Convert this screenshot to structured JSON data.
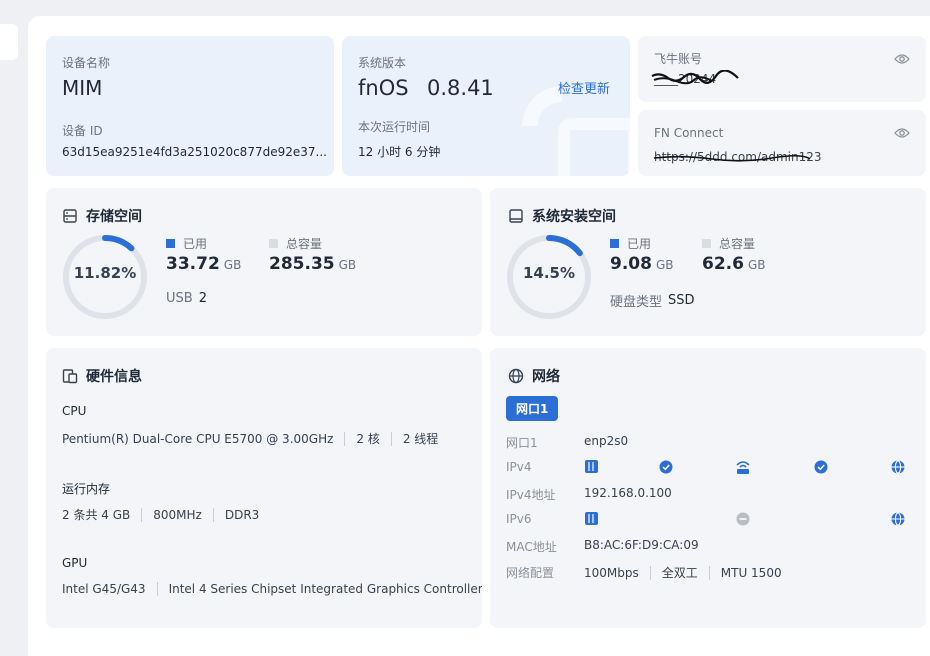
{
  "device": {
    "name_label": "设备名称",
    "name": "MIM",
    "id_label": "设备 ID",
    "id": "63d15ea9251e4fd3a251020c877de92e37..."
  },
  "system": {
    "version_label": "系统版本",
    "os_name": "fnOS",
    "version": "0.8.41",
    "check_update": "检查更新",
    "uptime_label": "本次运行时间",
    "uptime": "12 小时 6 分钟"
  },
  "account": {
    "label": "飞牛账号",
    "value": "____20244"
  },
  "fn_connect": {
    "label": "FN Connect",
    "value": "https://5ddd.com/admin123"
  },
  "storage": {
    "title": "存储空间",
    "percent": "11.82%",
    "percent_value": 11.82,
    "used_label": "已用",
    "used_value": "33.72",
    "used_unit": "GB",
    "total_label": "总容量",
    "total_value": "285.35",
    "total_unit": "GB",
    "usb_label": "USB",
    "usb_value": "2"
  },
  "sys_storage": {
    "title": "系统安装空间",
    "percent": "14.5%",
    "percent_value": 14.5,
    "used_label": "已用",
    "used_value": "9.08",
    "used_unit": "GB",
    "total_label": "总容量",
    "total_value": "62.6",
    "total_unit": "GB",
    "disk_type_label": "硬盘类型",
    "disk_type": "SSD"
  },
  "hardware": {
    "title": "硬件信息",
    "cpu_label": "CPU",
    "cpu_model": "Pentium(R) Dual-Core CPU E5700 @ 3.00GHz",
    "cpu_cores": "2 核",
    "cpu_threads": "2 线程",
    "mem_label": "运行内存",
    "mem_sticks": "2 条共 4 GB",
    "mem_freq": "800MHz",
    "mem_type": "DDR3",
    "gpu_label": "GPU",
    "gpu_model": "Intel G45/G43",
    "gpu_desc": "Intel 4 Series Chipset Integrated Graphics Controller"
  },
  "network": {
    "title": "网络",
    "port_tab": "网口1",
    "rows": [
      {
        "label": "网口1",
        "value": "enp2s0"
      },
      {
        "label": "IPv4",
        "value": ""
      },
      {
        "label": "IPv4地址",
        "value": "192.168.0.100"
      },
      {
        "label": "IPv6",
        "value": ""
      },
      {
        "label": "MAC地址",
        "value": "B8:AC:6F:D9:CA:09"
      }
    ],
    "config_label": "网络配置",
    "speed": "100Mbps",
    "duplex": "全双工",
    "mtu": "MTU 1500"
  },
  "colors": {
    "accent": "#2b6fd6",
    "ring_track": "#dfe3e9"
  },
  "icons": [
    "eye-icon",
    "storage-icon",
    "disk-icon",
    "hardware-icon",
    "globe-icon",
    "nas-icon",
    "check-icon",
    "router-icon"
  ]
}
